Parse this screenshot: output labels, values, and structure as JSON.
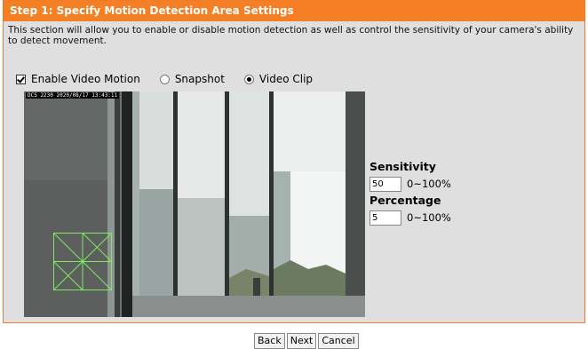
{
  "header": {
    "title": "Step 1: Specify Motion Detection Area Settings"
  },
  "description": "This section will allow you to enable or disable motion detection as well as control the sensitivity of your camera's ability to detect movement.",
  "options": {
    "enable_label": "Enable Video Motion",
    "enable_checked": true,
    "snapshot_label": "Snapshot",
    "videoclip_label": "Video Clip",
    "selected": "Video Clip"
  },
  "video": {
    "timestamp": "DCS 2230 2020/08/17 13:43:11"
  },
  "settings": {
    "sensitivity_label": "Sensitivity",
    "sensitivity_value": "50",
    "sensitivity_range": "0~100%",
    "percentage_label": "Percentage",
    "percentage_value": "5",
    "percentage_range": "0~100%"
  },
  "buttons": {
    "back": "Back",
    "next": "Next",
    "cancel": "Cancel"
  },
  "colors": {
    "header": "#f47f24",
    "panel": "#dfdfdf",
    "grid": "#7dea60"
  }
}
